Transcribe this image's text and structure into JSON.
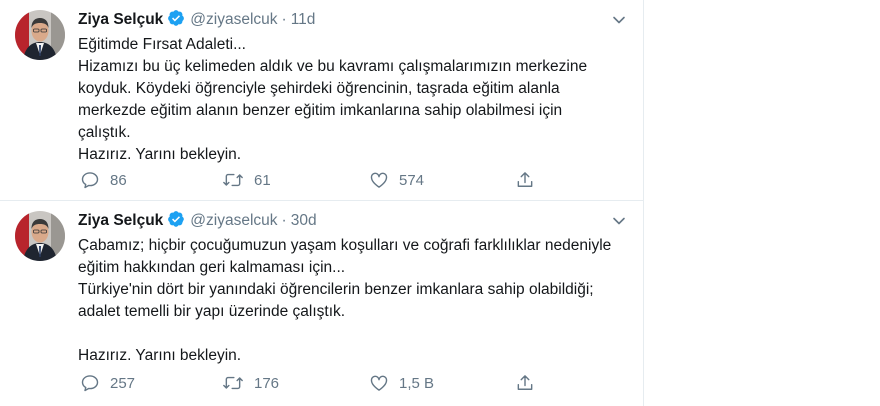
{
  "tweets": [
    {
      "name": "Ziya Selçuk",
      "handle": "@ziyaselcuk",
      "separator": "·",
      "time": "11d",
      "lines": [
        "Eğitimde Fırsat Adaleti...",
        "Hizamızı bu üç kelimeden aldık ve bu kavramı çalışmalarımızın merkezine",
        "koyduk. Köydeki öğrenciyle şehirdeki öğrencinin, taşrada eğitim alanla",
        "merkezde eğitim alanın benzer eğitim imkanlarına sahip olabilmesi için",
        "çalıştık.",
        "Hazırız. Yarını bekleyin."
      ],
      "replies": "86",
      "retweets": "61",
      "likes": "574"
    },
    {
      "name": "Ziya Selçuk",
      "handle": "@ziyaselcuk",
      "separator": "·",
      "time": "30d",
      "lines": [
        "Çabamız; hiçbir çocuğumuzun yaşam koşulları ve coğrafi farklılıklar nedeniyle",
        "eğitim hakkından geri kalmaması için...",
        "Türkiye'nin dört bir yanındaki öğrencilerin benzer imkanlara sahip olabildiği;",
        "adalet temelli bir yapı üzerinde çalıştık.",
        "",
        "Hazırız. Yarını bekleyin."
      ],
      "replies": "257",
      "retweets": "176",
      "likes": "1,5 B"
    }
  ],
  "icons": {
    "verified": "verified-badge-icon",
    "reply": "reply-icon",
    "retweet": "retweet-icon",
    "like": "heart-icon",
    "share": "share-icon",
    "more": "chevron-down-icon"
  },
  "colors": {
    "text": "#14171a",
    "secondary": "#657786",
    "verified": "#1da1f2",
    "divider": "#e6ecf0"
  }
}
